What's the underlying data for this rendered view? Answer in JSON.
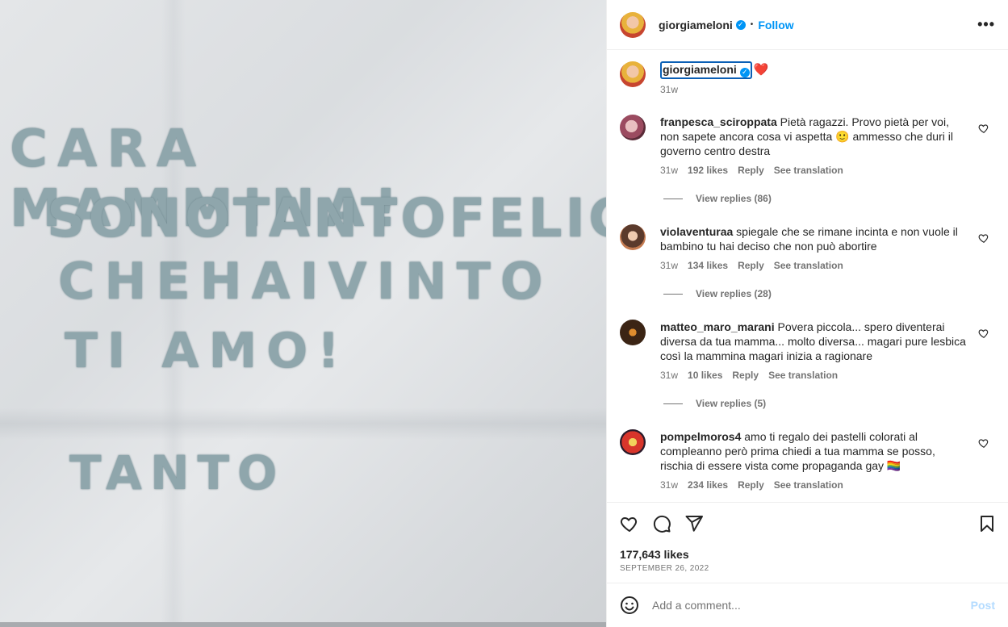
{
  "media": {
    "letter_lines": [
      "CARA MAMMINA!",
      "SONOTANTOFELICE",
      "CHEHAIVINTO",
      "TI AMO!",
      "TANTO"
    ]
  },
  "header": {
    "username": "giorgiameloni",
    "follow_label": "Follow",
    "separator": "•",
    "more_label": "•••",
    "avatar_icon": "profile-avatar"
  },
  "caption": {
    "username": "giorgiameloni",
    "emoji": "❤️",
    "time": "31w"
  },
  "comments": [
    {
      "username": "franpesca_sciroppata",
      "lines": [
        "Pietà ragazzi. Provo pietà per voi,",
        "non sapete ancora cosa vi aspetta 🙂 ammesso che duri il",
        "governo centro destra"
      ],
      "time": "31w",
      "likes": "192 likes",
      "reply": "Reply",
      "translate": "See translation",
      "view_replies": "View replies (86)"
    },
    {
      "username": "violaventuraa",
      "lines": [
        "spiegale che se rimane incinta e non vuole il",
        "bambino tu hai deciso che non può abortire"
      ],
      "time": "31w",
      "likes": "134 likes",
      "reply": "Reply",
      "translate": "See translation",
      "view_replies": "View replies (28)"
    },
    {
      "username": "matteo_maro_marani",
      "lines": [
        "Povera piccola... spero diventerai",
        "diversa da tua mamma... molto diversa... magari pure lesbica",
        "così la mammina magari inizia a ragionare"
      ],
      "time": "31w",
      "likes": "10 likes",
      "reply": "Reply",
      "translate": "See translation",
      "view_replies": "View replies (5)"
    },
    {
      "username": "pompelmoros4",
      "lines": [
        "amo ti regalo dei pastelli colorati al",
        "compleanno però prima chiedi a tua mamma se posso,",
        "rischia di essere vista come propaganda gay 🏳️‍🌈"
      ],
      "time": "31w",
      "likes": "234 likes",
      "reply": "Reply",
      "translate": "See translation"
    }
  ],
  "actions": {
    "likes": "177,643 likes",
    "date": "SEPTEMBER 26, 2022"
  },
  "composer": {
    "placeholder": "Add a comment...",
    "post_label": "Post"
  },
  "colors": {
    "accent": "#0095f6",
    "post_disabled": "#b3dbff",
    "muted": "#737373"
  }
}
